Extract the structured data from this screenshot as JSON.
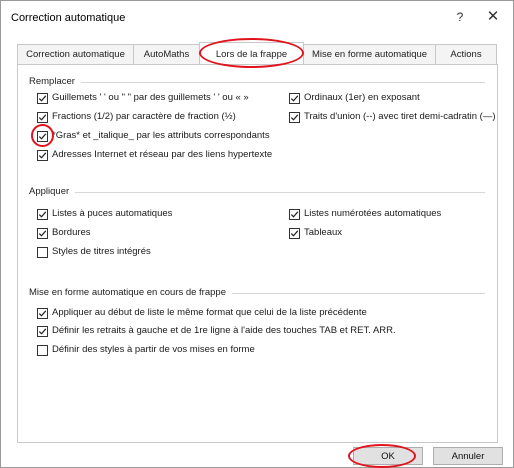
{
  "window": {
    "title": "Correction automatique",
    "help_label": "?",
    "close_label": "✕"
  },
  "tabs": [
    {
      "label": "Correction automatique",
      "active": false
    },
    {
      "label": "AutoMaths",
      "active": false
    },
    {
      "label": "Lors de la frappe",
      "active": true
    },
    {
      "label": "Mise en forme automatique",
      "active": false
    },
    {
      "label": "Actions",
      "active": false
    }
  ],
  "groups": {
    "remplacer": {
      "title": "Remplacer",
      "options": [
        {
          "label": "Guillemets ' ' ou \" \" par des guillemets ' ' ou « »",
          "checked": true
        },
        {
          "label": "Ordinaux (1er) en exposant",
          "checked": true
        },
        {
          "label": "Fractions (1/2) par caractère de fraction (½)",
          "checked": true
        },
        {
          "label": "Traits d'union (--) avec tiret demi-cadratin (—)",
          "checked": true
        },
        {
          "label": "*Gras* et _italique_ par les attributs correspondants",
          "checked": true
        },
        {
          "label": "Adresses Internet et réseau par des liens hypertexte",
          "checked": true
        }
      ]
    },
    "appliquer": {
      "title": "Appliquer",
      "options": [
        {
          "label": "Listes à puces automatiques",
          "checked": true
        },
        {
          "label": "Listes numérotées automatiques",
          "checked": true
        },
        {
          "label": "Bordures",
          "checked": true
        },
        {
          "label": "Tableaux",
          "checked": true
        },
        {
          "label": "Styles de titres intégrés",
          "checked": false
        }
      ]
    },
    "mise_en_forme": {
      "title": "Mise en forme automatique en cours de frappe",
      "options": [
        {
          "label": "Appliquer au début de liste le même format que celui de la liste précédente",
          "checked": true
        },
        {
          "label": "Définir les retraits à gauche et de 1re ligne à l'aide des touches TAB et RET. ARR.",
          "checked": true
        },
        {
          "label": "Définir des styles à partir de vos mises en forme",
          "checked": false
        }
      ]
    }
  },
  "buttons": {
    "ok": "OK",
    "cancel": "Annuler"
  },
  "colors": {
    "annotation": "#e0141e",
    "border": "#c8c8c8",
    "button_bg": "#e1e1e1"
  }
}
